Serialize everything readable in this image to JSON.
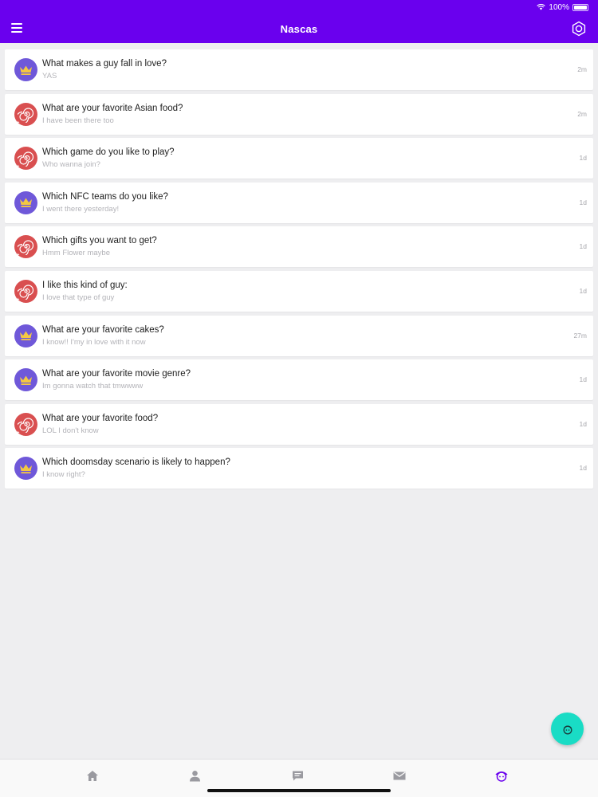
{
  "status_bar": {
    "battery": "100%"
  },
  "header": {
    "title": "Nascas"
  },
  "icons": {
    "menu": "menu-icon",
    "settings": "gear-icon",
    "crown": "crown-icon",
    "spiral": "spiral-icon",
    "home": "home-icon",
    "profile": "user-icon",
    "chat": "chat-icon",
    "mail": "mail-icon",
    "face": "face-icon"
  },
  "colors": {
    "brand": "#6a00ee",
    "crown_avatar": "#6f58d9",
    "spiral_avatar": "#d94f50",
    "fab": "#19dcc5"
  },
  "items": [
    {
      "title": "What makes a guy fall in love?",
      "subtitle": "YAS",
      "time": "2m",
      "avatar": "crown"
    },
    {
      "title": "What are your favorite Asian food?",
      "subtitle": "I have been there too",
      "time": "2m",
      "avatar": "spiral"
    },
    {
      "title": "Which game do you like to play?",
      "subtitle": "Who wanna join?",
      "time": "1d",
      "avatar": "spiral"
    },
    {
      "title": "Which NFC teams do you like?",
      "subtitle": "I went there yesterday!",
      "time": "1d",
      "avatar": "crown"
    },
    {
      "title": "Which gifts you want to get?",
      "subtitle": "Hmm Flower maybe",
      "time": "1d",
      "avatar": "spiral"
    },
    {
      "title": "I like this kind of guy:",
      "subtitle": "I love that type of guy",
      "time": "1d",
      "avatar": "spiral"
    },
    {
      "title": "What are your favorite cakes?",
      "subtitle": "I know!! I'my in love with it now",
      "time": "27m",
      "avatar": "crown"
    },
    {
      "title": "What are your favorite movie genre?",
      "subtitle": "Im gonna watch that tmwwww",
      "time": "1d",
      "avatar": "crown"
    },
    {
      "title": "What are your favorite food?",
      "subtitle": "LOL I don't know",
      "time": "1d",
      "avatar": "spiral"
    },
    {
      "title": "Which doomsday scenario is likely to happen?",
      "subtitle": "I know right?",
      "time": "1d",
      "avatar": "crown"
    }
  ]
}
